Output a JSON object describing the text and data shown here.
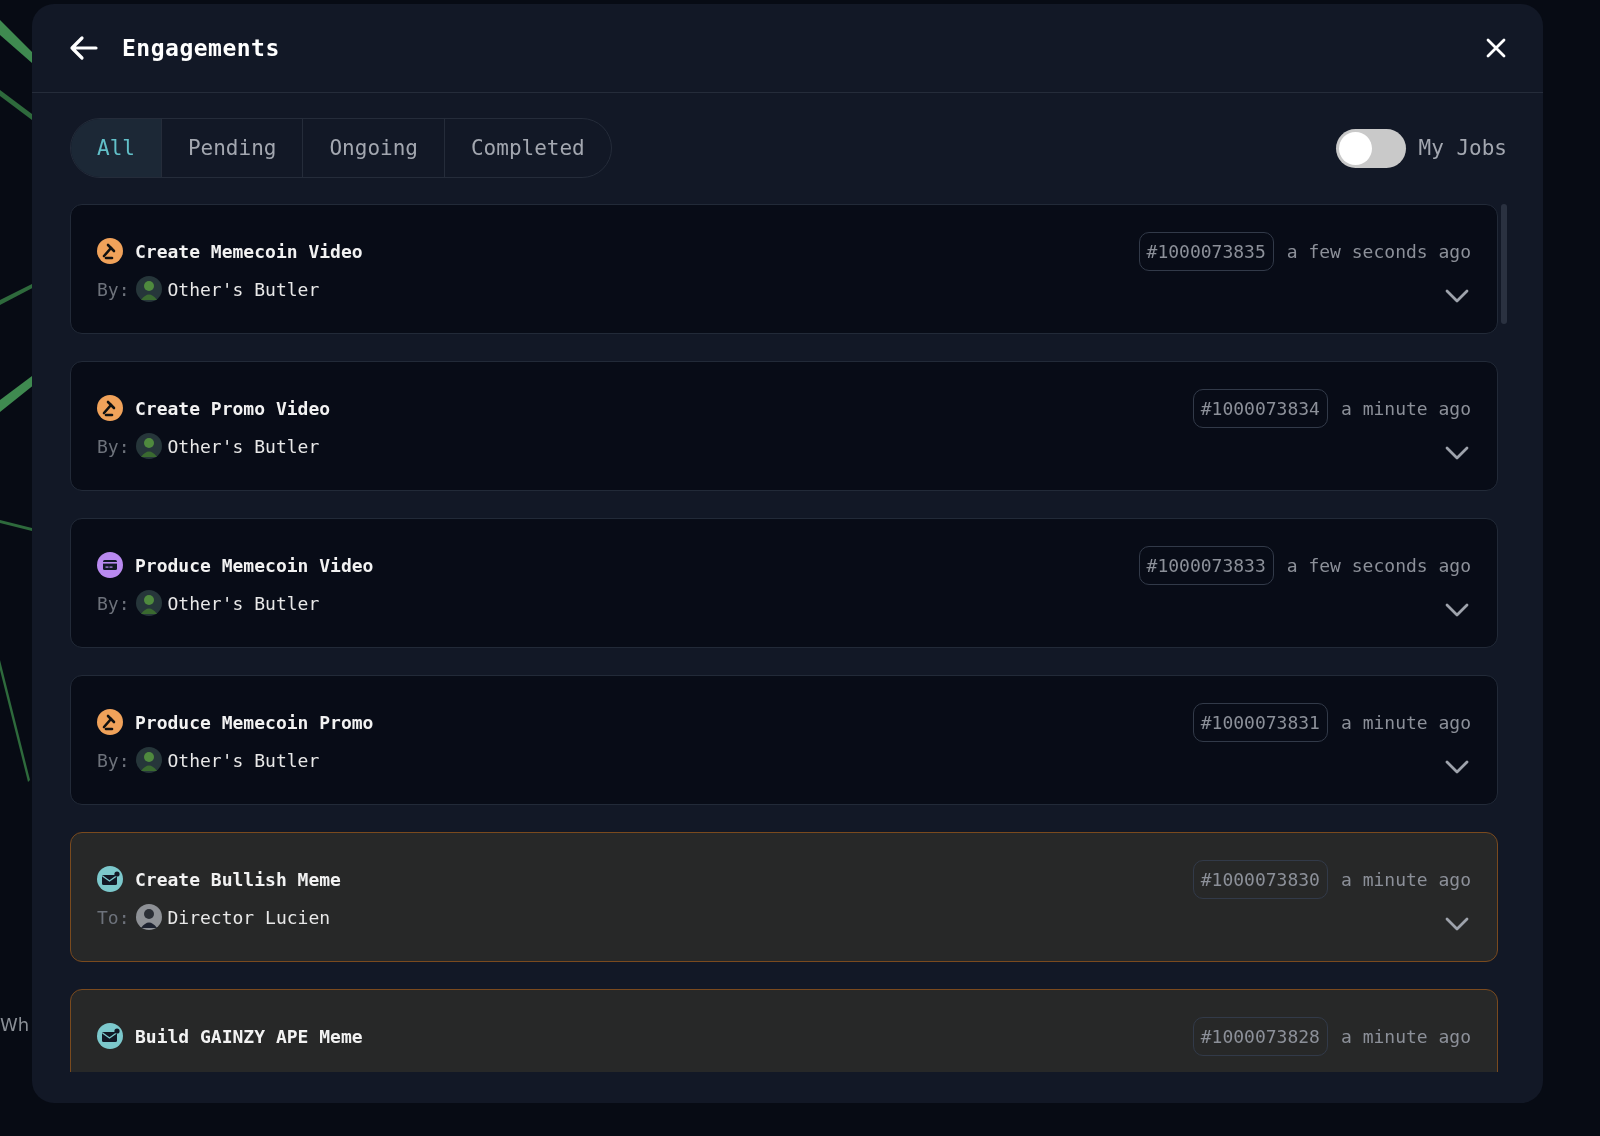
{
  "background": {
    "text": "Wh"
  },
  "window": {
    "title": "Engagements"
  },
  "tabs": [
    {
      "label": "All",
      "selected": true
    },
    {
      "label": "Pending",
      "selected": false
    },
    {
      "label": "Ongoing",
      "selected": false
    },
    {
      "label": "Completed",
      "selected": false
    }
  ],
  "my_jobs": {
    "label": "My Jobs",
    "on": false
  },
  "engagements": [
    {
      "kind": "gavel",
      "title": "Create Memecoin Video",
      "party_label": "By:",
      "party": "Other's Butler",
      "id": "#1000073835",
      "time": "a few seconds ago",
      "highlighted": false
    },
    {
      "kind": "gavel",
      "title": "Create Promo Video",
      "party_label": "By:",
      "party": "Other's Butler",
      "id": "#1000073834",
      "time": "a minute ago",
      "highlighted": false
    },
    {
      "kind": "card",
      "title": "Produce Memecoin Video",
      "party_label": "By:",
      "party": "Other's Butler",
      "id": "#1000073833",
      "time": "a few seconds ago",
      "highlighted": false
    },
    {
      "kind": "gavel",
      "title": "Produce Memecoin Promo",
      "party_label": "By:",
      "party": "Other's Butler",
      "id": "#1000073831",
      "time": "a minute ago",
      "highlighted": false
    },
    {
      "kind": "mail",
      "title": "Create Bullish Meme",
      "party_label": "To:",
      "party": "Director Lucien",
      "id": "#1000073830",
      "time": "a minute ago",
      "highlighted": true
    },
    {
      "kind": "mail",
      "title": "Build GAINZY APE Meme",
      "id": "#1000073828",
      "time": "a minute ago",
      "highlighted": true
    }
  ]
}
